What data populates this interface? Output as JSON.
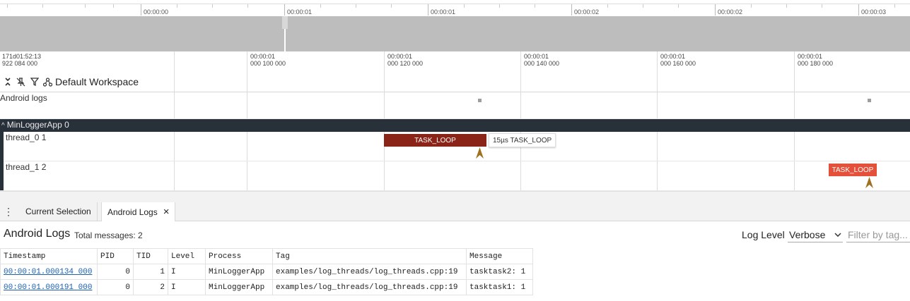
{
  "overview": {
    "labels": [
      "00:00:00",
      "00:00:01",
      "00:00:01",
      "00:00:02",
      "00:00:02",
      "00:00:03"
    ]
  },
  "timeline": {
    "offset_line1": "171d01:52:13",
    "offset_line2": "922 084 000",
    "ticks": [
      {
        "line1": "00:00:01",
        "line2": "000 100 000"
      },
      {
        "line1": "00:00:01",
        "line2": "000 120 000"
      },
      {
        "line1": "00:00:01",
        "line2": "000 140 000"
      },
      {
        "line1": "00:00:01",
        "line2": "000 160 000"
      },
      {
        "line1": "00:00:01",
        "line2": "000 180 000"
      }
    ]
  },
  "workspace": {
    "name": "Default Workspace",
    "icons": [
      "collapse-all-icon",
      "unpin-icon",
      "filter-icon",
      "workspace-icon"
    ]
  },
  "tracks": {
    "android_logs": "Android logs",
    "group": {
      "title": "MinLoggerApp 0",
      "chevron": "^"
    },
    "thread0": {
      "title": "thread_0 1",
      "slice": "TASK_LOOP",
      "slice_color": "#8b2418",
      "tooltip": "15µs TASK_LOOP"
    },
    "thread1": {
      "title": "thread_1 2",
      "slice": "TASK_LOOP",
      "slice_color": "#e4503a"
    }
  },
  "tabs": {
    "menu_icon": "⋮",
    "current_selection": "Current Selection",
    "android_logs": "Android Logs",
    "close": "×"
  },
  "logs": {
    "title": "Android Logs",
    "total": "Total messages: 2",
    "log_level_label": "Log Level",
    "log_level_value": "Verbose",
    "filter_placeholder": "Filter by tag...",
    "columns": [
      "Timestamp",
      "PID",
      "TID",
      "Level",
      "Process",
      "Tag",
      "Message"
    ],
    "rows": [
      {
        "ts_main": "00:00:01.000",
        "ts_micro": "134",
        "ts_nano": "000",
        "pid": "0",
        "tid": "1",
        "level": "I",
        "process": "MinLoggerApp",
        "tag": "examples/log_threads/log_threads.cpp:19",
        "message": "tasktask2: 1"
      },
      {
        "ts_main": "00:00:01.000",
        "ts_micro": "191",
        "ts_nano": "000",
        "pid": "0",
        "tid": "2",
        "level": "I",
        "process": "MinLoggerApp",
        "tag": "examples/log_threads/log_threads.cpp:19",
        "message": "tasktask1: 1"
      }
    ]
  },
  "colors": {
    "group_header": "#283039",
    "link": "#1a5fb4",
    "marker_arrow": "#a0701e"
  }
}
